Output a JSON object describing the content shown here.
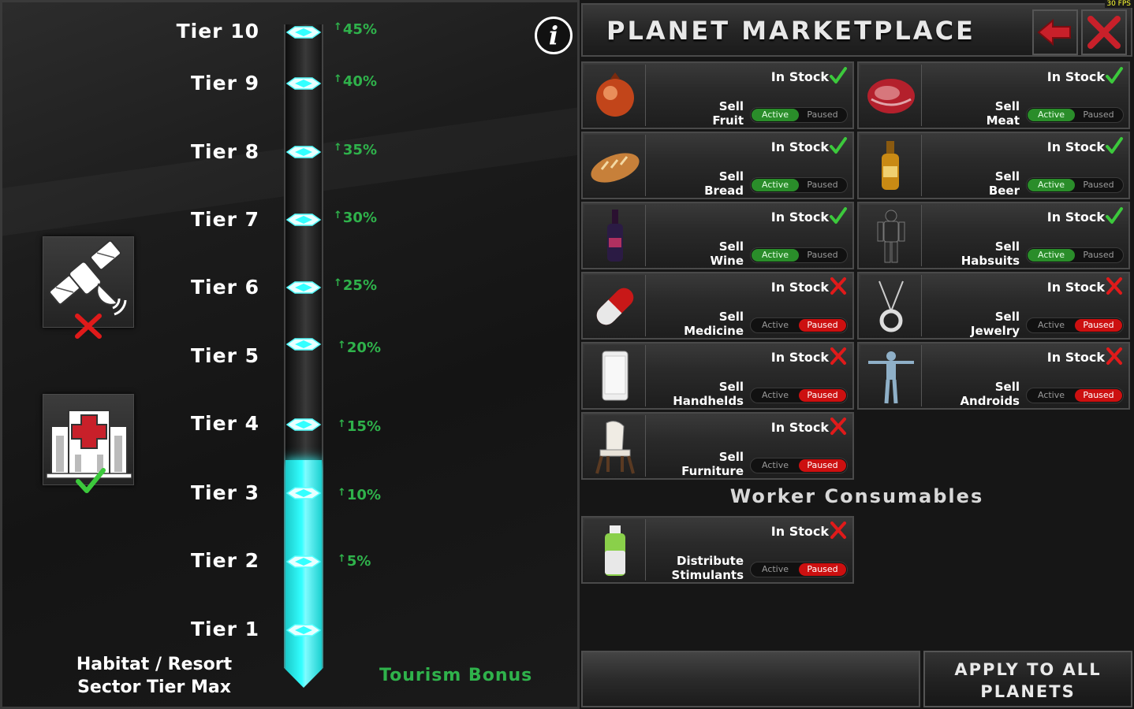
{
  "tiers": {
    "labels": [
      "Tier 10",
      "Tier 9",
      "Tier 8",
      "Tier 7",
      "Tier 6",
      "Tier 5",
      "Tier 4",
      "Tier 3",
      "Tier 2",
      "Tier 1"
    ],
    "bonuses": [
      "45%",
      "40%",
      "35%",
      "30%",
      "25%",
      "20%",
      "15%",
      "10%",
      "5%"
    ],
    "fill_level_tiers": 3,
    "max_tier": 10
  },
  "left": {
    "habitat_label_line1": "Habitat / Resort",
    "habitat_label_line2": "Sector Tier Max",
    "tourism_label": "Tourism Bonus",
    "info_glyph": "i",
    "sector_icons": [
      {
        "icon": "satellite-icon",
        "status": "cross-icon"
      },
      {
        "icon": "hospital-icon",
        "status": "check-icon"
      }
    ]
  },
  "header": {
    "title": "PLANET MARKETPLACE",
    "fps": "30 FPS",
    "back_icon": "back-arrow-icon",
    "close_icon": "close-icon"
  },
  "goods": [
    {
      "name": "Fruit",
      "verb": "Sell",
      "stock_label": "In Stock",
      "in_stock": true,
      "active_label": "Active",
      "paused_label": "Paused",
      "state": "active",
      "icon": "pomegranate-icon"
    },
    {
      "name": "Meat",
      "verb": "Sell",
      "stock_label": "In Stock",
      "in_stock": true,
      "active_label": "Active",
      "paused_label": "Paused",
      "state": "active",
      "icon": "steak-icon"
    },
    {
      "name": "Bread",
      "verb": "Sell",
      "stock_label": "In Stock",
      "in_stock": true,
      "active_label": "Active",
      "paused_label": "Paused",
      "state": "active",
      "icon": "bread-icon"
    },
    {
      "name": "Beer",
      "verb": "Sell",
      "stock_label": "In Stock",
      "in_stock": true,
      "active_label": "Active",
      "paused_label": "Paused",
      "state": "active",
      "icon": "beer-bottle-icon"
    },
    {
      "name": "Wine",
      "verb": "Sell",
      "stock_label": "In Stock",
      "in_stock": true,
      "active_label": "Active",
      "paused_label": "Paused",
      "state": "active",
      "icon": "wine-bottle-icon"
    },
    {
      "name": "Habsuits",
      "verb": "Sell",
      "stock_label": "In Stock",
      "in_stock": true,
      "active_label": "Active",
      "paused_label": "Paused",
      "state": "active",
      "icon": "habsuit-icon"
    },
    {
      "name": "Medicine",
      "verb": "Sell",
      "stock_label": "In Stock",
      "in_stock": false,
      "active_label": "Active",
      "paused_label": "Paused",
      "state": "paused",
      "icon": "pill-icon"
    },
    {
      "name": "Jewelry",
      "verb": "Sell",
      "stock_label": "In Stock",
      "in_stock": false,
      "active_label": "Active",
      "paused_label": "Paused",
      "state": "paused",
      "icon": "necklace-icon"
    },
    {
      "name": "Handhelds",
      "verb": "Sell",
      "stock_label": "In Stock",
      "in_stock": false,
      "active_label": "Active",
      "paused_label": "Paused",
      "state": "paused",
      "icon": "phone-icon"
    },
    {
      "name": "Androids",
      "verb": "Sell",
      "stock_label": "In Stock",
      "in_stock": false,
      "active_label": "Active",
      "paused_label": "Paused",
      "state": "paused",
      "icon": "android-icon"
    },
    {
      "name": "Furniture",
      "verb": "Sell",
      "stock_label": "In Stock",
      "in_stock": false,
      "active_label": "Active",
      "paused_label": "Paused",
      "state": "paused",
      "icon": "chair-icon"
    }
  ],
  "worker": {
    "heading": "Worker Consumables",
    "items": [
      {
        "name": "Stimulants",
        "verb": "Distribute",
        "stock_label": "In Stock",
        "in_stock": false,
        "active_label": "Active",
        "paused_label": "Paused",
        "state": "paused",
        "icon": "stimulant-bottle-icon"
      }
    ]
  },
  "footer": {
    "apply_line1": "APPLY TO ALL",
    "apply_line2": "PLANETS"
  },
  "colors": {
    "accent_cyan": "#33ffff",
    "bonus_green": "#2fb24b",
    "active_green": "#2a8d2a",
    "paused_red": "#cc1010",
    "check_green": "#3cc93c",
    "cross_red": "#e01a1a"
  }
}
